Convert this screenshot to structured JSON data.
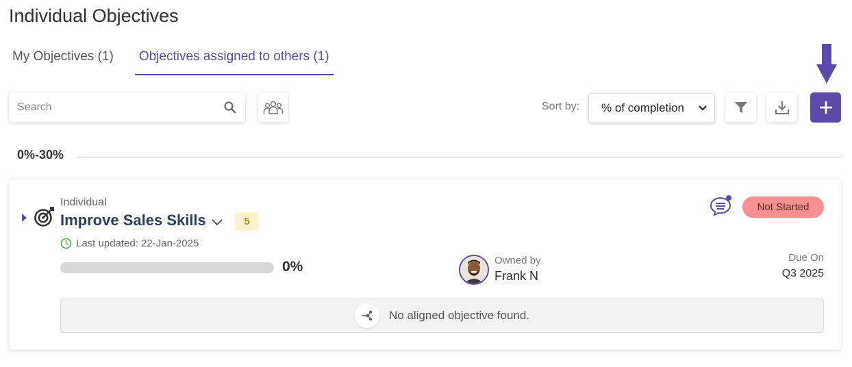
{
  "page": {
    "title": "Individual Objectives"
  },
  "tabs": [
    {
      "label": "My Objectives (1)",
      "active": false
    },
    {
      "label": "Objectives assigned to others (1)",
      "active": true
    }
  ],
  "toolbar": {
    "search_placeholder": "Search",
    "sort_label": "Sort by:",
    "sort_value": "% of completion",
    "icons": [
      "search-icon",
      "team-icon",
      "filter-icon",
      "download-icon",
      "plus-icon",
      "chevron-down-icon"
    ]
  },
  "group": {
    "label": "0%-30%"
  },
  "objective": {
    "type": "Individual",
    "title": "Improve Sales Skills",
    "count": "5",
    "last_updated": "Last updated: 22-Jan-2025",
    "progress": 0,
    "progress_label": "0%",
    "owned_label": "Owned by",
    "owner": "Frank N",
    "due_label": "Due On",
    "due_value": "Q3 2025",
    "status": "Not Started",
    "aligned_text": "No aligned objective found."
  },
  "colors": {
    "accent": "#5b4aa8",
    "status_not_started": "#f58f8f",
    "badge_bg": "#fdf3cf",
    "title": "#2d3f5f"
  }
}
